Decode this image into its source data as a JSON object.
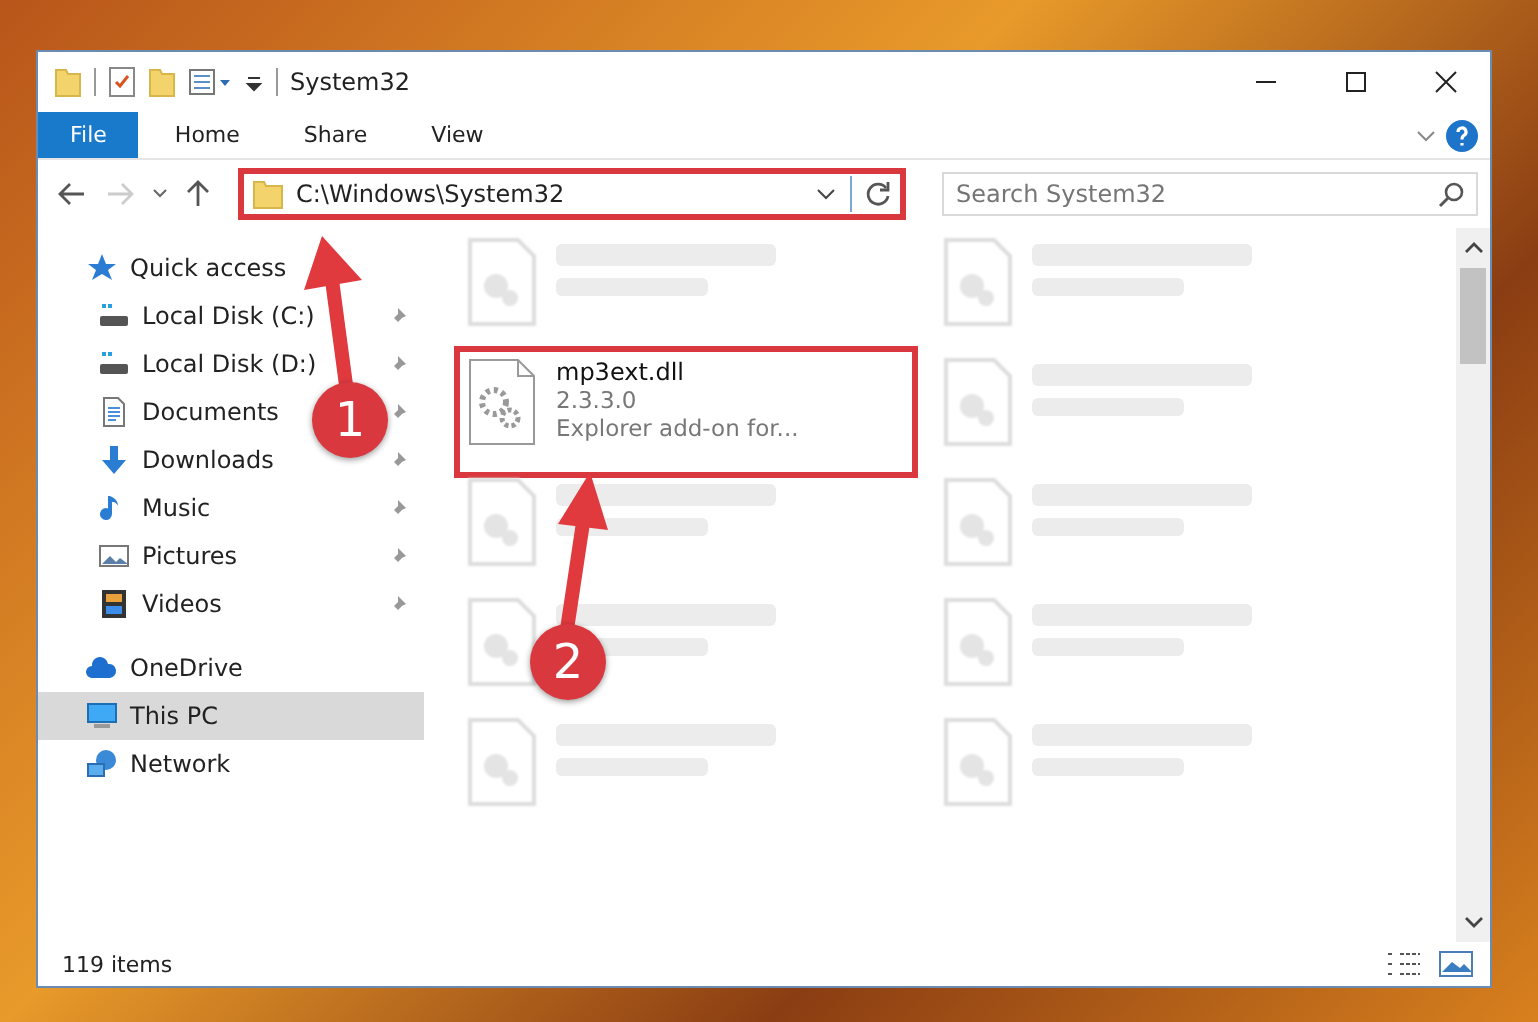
{
  "window": {
    "title": "System32"
  },
  "ribbon_tabs": [
    {
      "label": "File",
      "selected": true
    },
    {
      "label": "Home",
      "selected": false
    },
    {
      "label": "Share",
      "selected": false
    },
    {
      "label": "View",
      "selected": false
    }
  ],
  "navigation": {
    "forward_disabled": true
  },
  "address_bar": {
    "path": "C:\\Windows\\System32",
    "highlighted": true
  },
  "search": {
    "placeholder": "Search System32"
  },
  "sidebar": {
    "items": [
      {
        "label": "Quick access",
        "selected": false,
        "children": [
          {
            "label": "Local Disk (C:)",
            "pinned": true,
            "selected": false
          },
          {
            "label": "Local Disk (D:)",
            "pinned": true,
            "selected": false
          },
          {
            "label": "Documents",
            "pinned": true,
            "selected": false
          },
          {
            "label": "Downloads",
            "pinned": true,
            "selected": false
          },
          {
            "label": "Music",
            "pinned": true,
            "selected": false
          },
          {
            "label": "Pictures",
            "pinned": true,
            "selected": false
          },
          {
            "label": "Videos",
            "pinned": true,
            "selected": false
          }
        ]
      },
      {
        "label": "OneDrive",
        "selected": false
      },
      {
        "label": "This PC",
        "selected": true
      },
      {
        "label": "Network",
        "selected": false
      }
    ]
  },
  "files": [
    {
      "kind": "blurred"
    },
    {
      "kind": "blurred"
    },
    {
      "kind": "file",
      "name": "mp3ext.dll",
      "lines": [
        "2.3.3.0",
        "Explorer add-on for..."
      ],
      "highlighted": true
    },
    {
      "kind": "blurred"
    },
    {
      "kind": "blurred"
    },
    {
      "kind": "blurred"
    },
    {
      "kind": "blurred"
    },
    {
      "kind": "blurred"
    },
    {
      "kind": "blurred"
    },
    {
      "kind": "blurred"
    }
  ],
  "status_bar": {
    "item_count": "119 items"
  },
  "callouts": [
    {
      "number": "1"
    },
    {
      "number": "2"
    }
  ]
}
